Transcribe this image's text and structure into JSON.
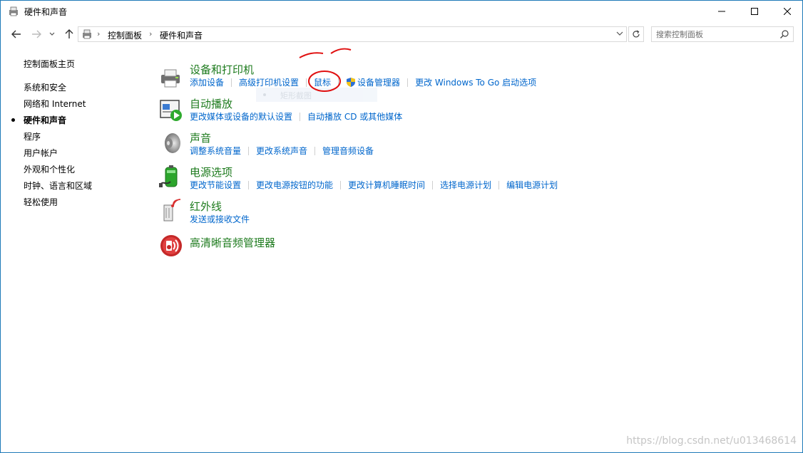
{
  "window": {
    "title": "硬件和声音",
    "icons": [
      "control-panel-icon",
      "minimize-icon",
      "maximize-icon",
      "close-icon"
    ]
  },
  "address_bar": {
    "breadcrumbs": [
      "控制面板",
      "硬件和声音"
    ],
    "search_placeholder": "搜索控制面板"
  },
  "sidebar": {
    "home": "控制面板主页",
    "items": [
      {
        "label": "系统和安全",
        "selected": false
      },
      {
        "label": "网络和 Internet",
        "selected": false
      },
      {
        "label": "硬件和声音",
        "selected": true
      },
      {
        "label": "程序",
        "selected": false
      },
      {
        "label": "用户帐户",
        "selected": false
      },
      {
        "label": "外观和个性化",
        "selected": false
      },
      {
        "label": "时钟、语言和区域",
        "selected": false
      },
      {
        "label": "轻松使用",
        "selected": false
      }
    ]
  },
  "categories": [
    {
      "title": "设备和打印机",
      "icon": "printer-icon",
      "links": [
        "添加设备",
        "高级打印机设置",
        "鼠标",
        "设备管理器",
        "更改 Windows To Go 启动选项"
      ]
    },
    {
      "title": "自动播放",
      "icon": "autoplay-icon",
      "links": [
        "更改媒体或设备的默认设置",
        "自动播放 CD 或其他媒体"
      ]
    },
    {
      "title": "声音",
      "icon": "speaker-icon",
      "links": [
        "调整系统音量",
        "更改系统声音",
        "管理音频设备"
      ]
    },
    {
      "title": "电源选项",
      "icon": "battery-icon",
      "links": [
        "更改节能设置",
        "更改电源按钮的功能",
        "更改计算机睡眠时间",
        "选择电源计划",
        "编辑电源计划"
      ]
    },
    {
      "title": "红外线",
      "icon": "infrared-icon",
      "links": [
        "发送或接收文件"
      ]
    },
    {
      "title": "高清晰音频管理器",
      "icon": "realtek-audio-icon",
      "links": []
    }
  ],
  "tooltip_ghost": "矩形截图",
  "watermark": "https://blog.csdn.net/u013468614",
  "colors": {
    "link": "#0066cc",
    "category_title": "#1e7b1e",
    "annotation": "#e01010"
  }
}
